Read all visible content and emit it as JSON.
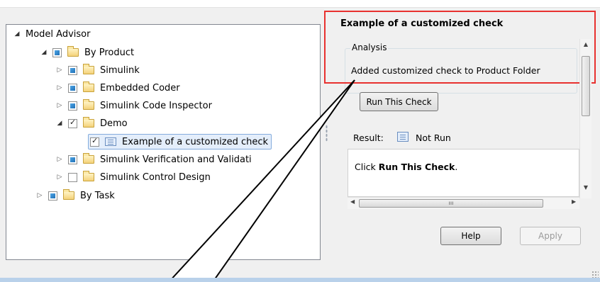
{
  "tree": {
    "items": [
      {
        "label": "Model Advisor",
        "expander": "open",
        "checkbox": null,
        "icon": null
      },
      {
        "label": "By Product",
        "expander": "open",
        "checkbox": "partial",
        "icon": "folder-icon"
      },
      {
        "label": "Simulink",
        "expander": "closed",
        "checkbox": "partial",
        "icon": "folder-icon"
      },
      {
        "label": "Embedded Coder",
        "expander": "closed",
        "checkbox": "partial",
        "icon": "folder-icon"
      },
      {
        "label": "Simulink Code Inspector",
        "expander": "closed",
        "checkbox": "partial",
        "icon": "folder-icon"
      },
      {
        "label": "Demo",
        "expander": "open",
        "checkbox": "checked",
        "icon": "folder-icon"
      },
      {
        "label": "Example of a customized check",
        "expander": null,
        "checkbox": "checked",
        "icon": "check-icon",
        "selected": true
      },
      {
        "label": "Simulink Verification and Validati",
        "expander": "closed",
        "checkbox": "partial",
        "icon": "folder-icon"
      },
      {
        "label": "Simulink Control Design",
        "expander": "closed",
        "checkbox": "unchecked",
        "icon": "folder-icon"
      },
      {
        "label": "By Task",
        "expander": "closed",
        "checkbox": "partial",
        "icon": "folder-icon"
      }
    ]
  },
  "details": {
    "title": "Example of a customized check",
    "analysis_label": "Analysis",
    "analysis_text": "Added customized check to Product Folder",
    "run_button": "Run This Check",
    "result_label": "Result:",
    "result_value": "Not Run",
    "result_message_prefix": "Click ",
    "result_message_bold": "Run This Check",
    "result_message_suffix": "."
  },
  "buttons": {
    "help": "Help",
    "apply": "Apply"
  },
  "colors": {
    "highlight": "#e8312f",
    "selection": "#e4eefb",
    "bottom_bar": "#b9d1ea"
  }
}
